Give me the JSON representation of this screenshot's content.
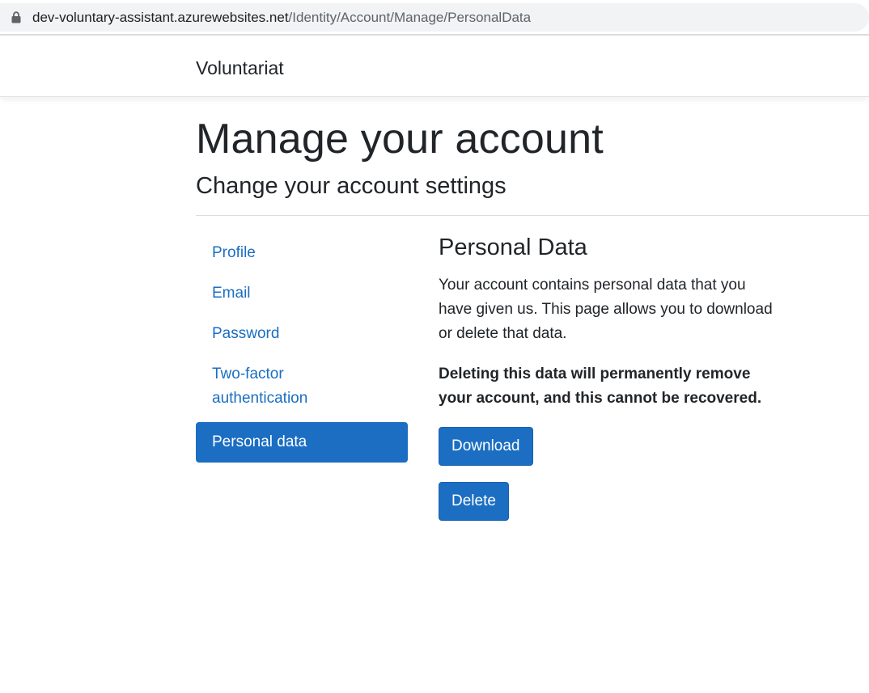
{
  "browser": {
    "url_host": "dev-voluntary-assistant.azurewebsites.net",
    "url_path": "/Identity/Account/Manage/PersonalData"
  },
  "navbar": {
    "brand": "Voluntariat"
  },
  "page": {
    "title": "Manage your account",
    "subtitle": "Change your account settings"
  },
  "sidenav": {
    "items": [
      {
        "label": "Profile",
        "active": false
      },
      {
        "label": "Email",
        "active": false
      },
      {
        "label": "Password",
        "active": false
      },
      {
        "label": "Two-factor authentication",
        "active": false
      },
      {
        "label": "Personal data",
        "active": true
      }
    ]
  },
  "personal_data": {
    "heading": "Personal Data",
    "description": "Your account contains personal data that you have given us. This page allows you to download or delete that data.",
    "warning": "Deleting this data will permanently remove your account, and this cannot be recovered.",
    "download_label": "Download",
    "delete_label": "Delete"
  },
  "colors": {
    "primary": "#1b6ec2",
    "text": "#212529",
    "omnibox_bg": "#f1f3f4"
  },
  "icons": {
    "lock": "lock-icon"
  }
}
